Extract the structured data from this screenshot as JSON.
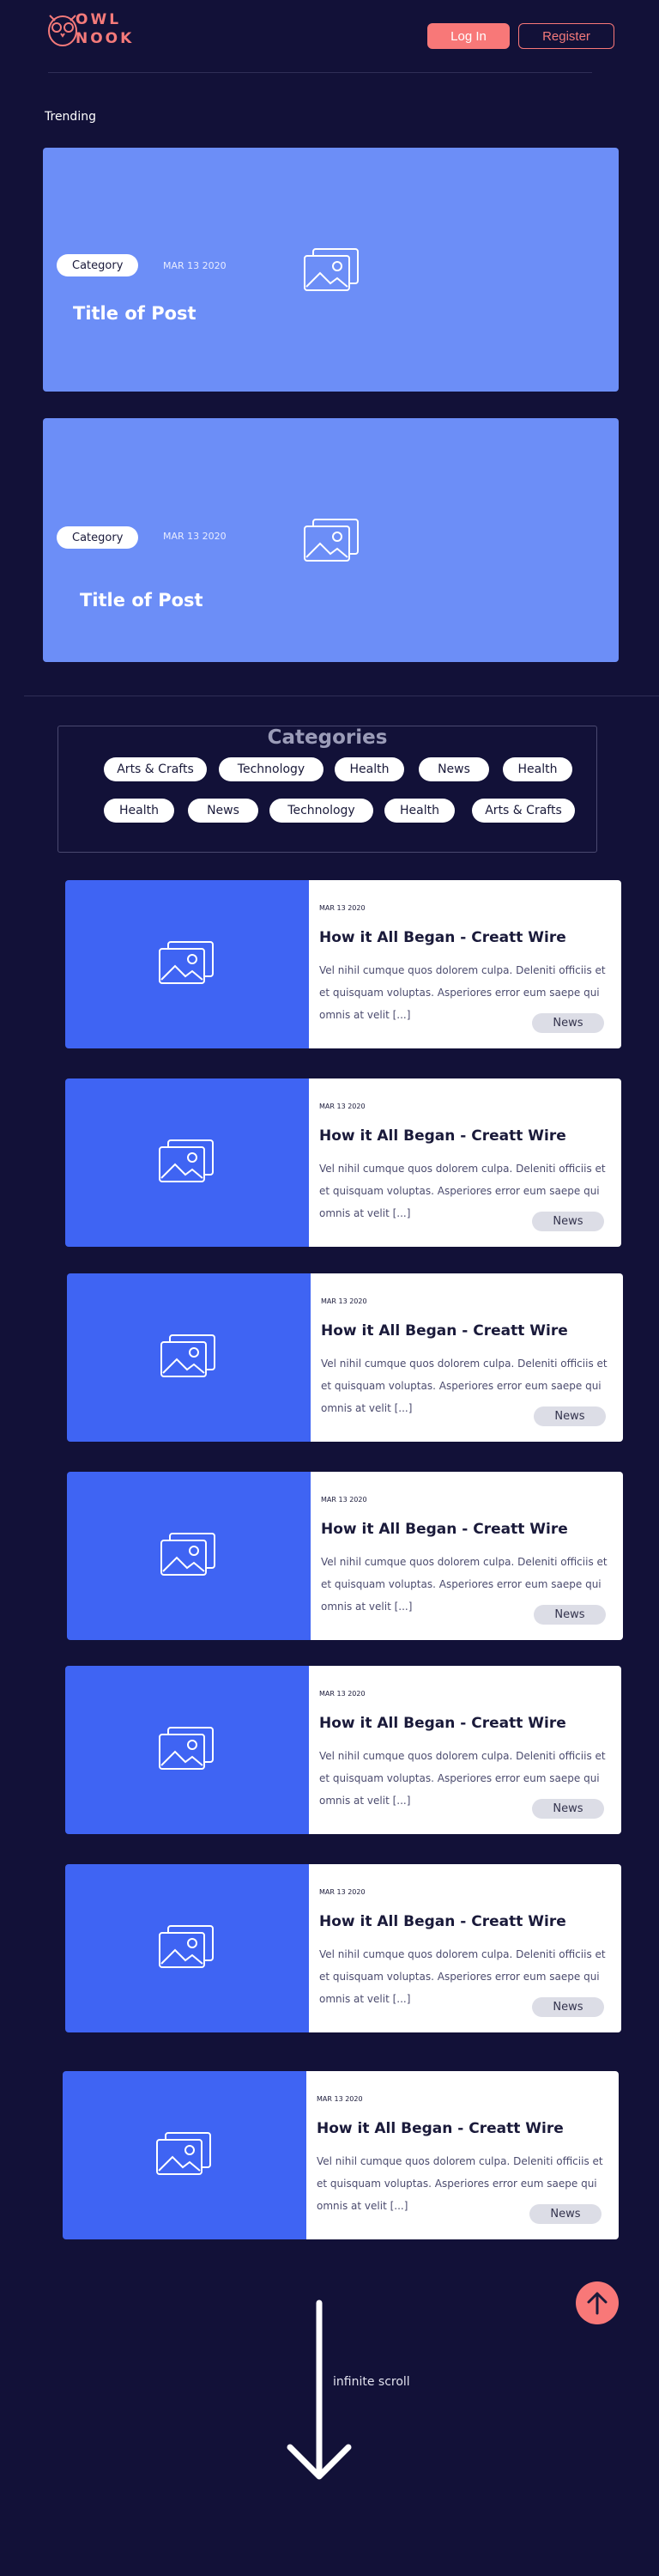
{
  "brand": {
    "name_line1": "OWL",
    "name_line2": "NOOK",
    "accent": "#f47a7a"
  },
  "header": {
    "login_label": "Log In",
    "register_label": "Register"
  },
  "trending": {
    "label": "Trending",
    "cards": [
      {
        "category": "Category",
        "date": "MAR 13 2020",
        "title": "Title of Post"
      },
      {
        "category": "Category",
        "date": "MAR 13 2020",
        "title": "Title of Post"
      }
    ]
  },
  "categories": {
    "title": "Categories",
    "row1": [
      "Arts & Crafts",
      "Technology",
      "Health",
      "News",
      "Health"
    ],
    "row2": [
      "Health",
      "News",
      "Technology",
      "Health",
      "Arts & Crafts"
    ]
  },
  "articles": [
    {
      "date": "MAR 13 2020",
      "title": "How it All Began - Creatt Wire",
      "excerpt": "Vel nihil cumque quos dolorem culpa. Deleniti officiis et et quisquam voluptas. Asperiores error eum saepe qui omnis at velit [...]",
      "tag": "News"
    },
    {
      "date": "MAR 13 2020",
      "title": "How it All Began - Creatt Wire",
      "excerpt": "Vel nihil cumque quos dolorem culpa. Deleniti officiis et et quisquam voluptas. Asperiores error eum saepe qui omnis at velit [...]",
      "tag": "News"
    },
    {
      "date": "MAR 13 2020",
      "title": "How it All Began - Creatt Wire",
      "excerpt": "Vel nihil cumque quos dolorem culpa. Deleniti officiis et et quisquam voluptas. Asperiores error eum saepe qui omnis at velit [...]",
      "tag": "News"
    },
    {
      "date": "MAR 13 2020",
      "title": "How it All Began - Creatt Wire",
      "excerpt": "Vel nihil cumque quos dolorem culpa. Deleniti officiis et et quisquam voluptas. Asperiores error eum saepe qui omnis at velit [...]",
      "tag": "News"
    },
    {
      "date": "MAR 13 2020",
      "title": "How it All Began - Creatt Wire",
      "excerpt": "Vel nihil cumque quos dolorem culpa. Deleniti officiis et et quisquam voluptas. Asperiores error eum saepe qui omnis at velit [...]",
      "tag": "News"
    },
    {
      "date": "MAR 13 2020",
      "title": "How it All Began - Creatt Wire",
      "excerpt": "Vel nihil cumque quos dolorem culpa. Deleniti officiis et et quisquam voluptas. Asperiores error eum saepe qui omnis at velit [...]",
      "tag": "News"
    },
    {
      "date": "MAR 13 2020",
      "title": "How it All Began - Creatt Wire",
      "excerpt": "Vel nihil cumque quos dolorem culpa. Deleniti officiis et et quisquam voluptas. Asperiores error eum saepe qui omnis at velit [...]",
      "tag": "News"
    }
  ],
  "footer": {
    "infinite_scroll_label": "infinite scroll",
    "scroll_top_icon": "arrow-up-icon"
  }
}
